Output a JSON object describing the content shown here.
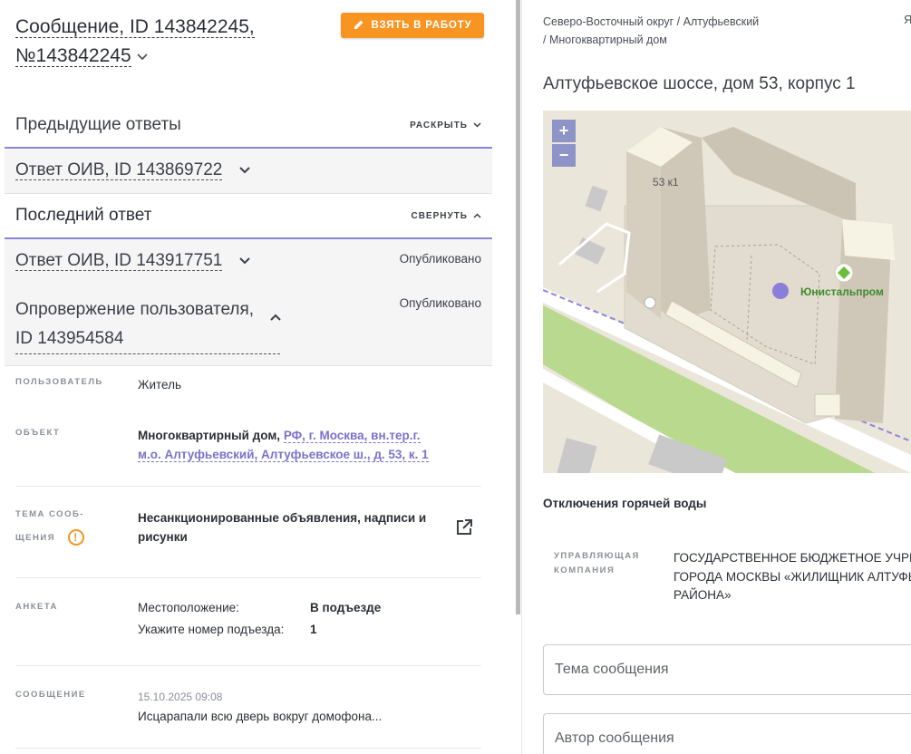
{
  "header": {
    "title_line1": "Сообщение, ID 143842245,",
    "title_line2": "№143842245",
    "take_button": "ВЗЯТЬ В РАБОТУ"
  },
  "previous": {
    "title": "Предыдущие ответы",
    "toggle": "РАСКРЫТЬ",
    "item": "Ответ ОИВ, ID 143869722"
  },
  "last": {
    "title": "Последний ответ",
    "toggle": "СВЕРНУТЬ",
    "answer": "Ответ ОИВ, ID 143917751",
    "answer_status": "Опубликовано",
    "refutation_line1": "Опровержение пользователя,",
    "refutation_line2": "ID 143954584",
    "refutation_status": "Опубликовано"
  },
  "details": {
    "user_label": "ПОЛЬЗОВАТЕЛЬ",
    "user_value": "Житель",
    "object_label": "ОБЪЕКТ",
    "object_type": "Многоквартирный дом,",
    "object_link_line1": "РФ, г. Москва, вн.тер.г.",
    "object_link_line2": "м.о. Алтуфьевский, Алтуфьевское ш., д. 53, к. 1",
    "topic_label_line1": "ТЕМА СООБ-",
    "topic_label_line2": "ЩЕНИЯ",
    "topic_value_line1": "Несанкционированные объявления, надписи и",
    "topic_value_line2": "рисунки",
    "form_label": "АНКЕТА",
    "form_q1": "Местоположение:",
    "form_a1": "В подъезде",
    "form_q2": "Укажите номер подъезда:",
    "form_a2": "1",
    "message_label": "СООБЩЕНИЕ",
    "message_date": "15.10.2025 09:08",
    "message_text": "Исцарапали всю дверь вокруг домофона..."
  },
  "right": {
    "breadcrumb_line1": "Северо-Восточный округ / Алтуфьевский",
    "breadcrumb_line2": "/ Многоквартирный дом",
    "cut_letter": "Я",
    "address": "Алтуфьевское шоссе, дом 53, корпус 1",
    "map": {
      "building_label": "53 к1",
      "poi_label": "Юнистальпром",
      "zoom_in": "+",
      "zoom_out": "−"
    },
    "hot_water": "Отключения горячей воды",
    "mgmt_label_line1": "УПРАВЛЯЮЩАЯ",
    "mgmt_label_line2": "КОМПАНИЯ",
    "mgmt_line1": "ГОСУДАРСТВЕННОЕ БЮДЖЕТНОЕ УЧРЕЖ",
    "mgmt_line2": "ГОРОДА МОСКВЫ «ЖИЛИЩНИК АЛТУФЬ",
    "mgmt_line3": "РАЙОНА»",
    "topic_placeholder": "Тема сообщения",
    "author_placeholder": "Автор сообщения"
  },
  "colors": {
    "accent": "#f79422",
    "purple": "#7b72cc",
    "divider": "#8a85d6"
  }
}
